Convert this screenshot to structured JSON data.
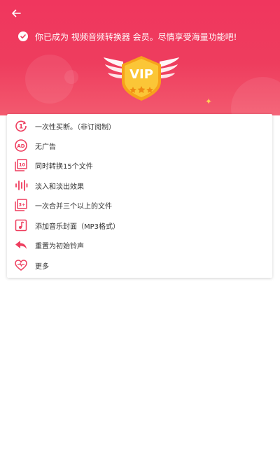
{
  "header": {
    "back_icon": "arrow-left-icon",
    "member_text": "你已成为 视频音频转换器 会员。尽情享受海量功能吧!",
    "badge_text": "VIP"
  },
  "colors": {
    "primary": "#ee3d5e",
    "gold": "#f7c33b",
    "text": "#333333"
  },
  "benefits": [
    {
      "icon": "one-time-icon",
      "label": "一次性买断。（非订阅制）"
    },
    {
      "icon": "no-ads-icon",
      "label": "无广告"
    },
    {
      "icon": "batch-10-icon",
      "label": "同时转换15个文件"
    },
    {
      "icon": "waveform-icon",
      "label": "淡入和淡出效果"
    },
    {
      "icon": "merge-3plus-icon",
      "label": "一次合并三个以上的文件"
    },
    {
      "icon": "music-note-icon",
      "label": "添加音乐封面（MP3格式）"
    },
    {
      "icon": "reply-arrow-icon",
      "label": "重置为初始铃声"
    },
    {
      "icon": "heart-icon",
      "label": "更多"
    }
  ]
}
